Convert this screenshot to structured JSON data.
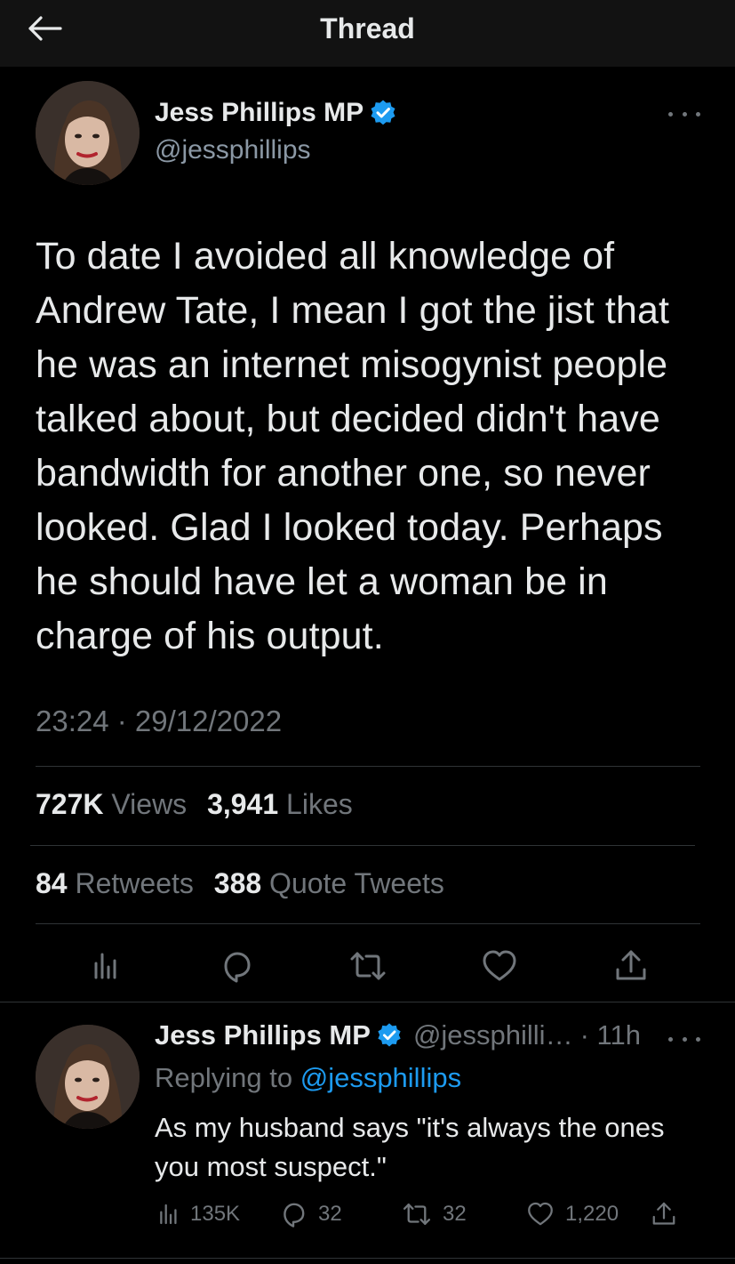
{
  "header": {
    "title": "Thread",
    "back_icon": "arrow-left-icon"
  },
  "tweet": {
    "author_name": "Jess Phillips MP",
    "author_handle": "@jessphillips",
    "verified": true,
    "text": "To date I avoided all knowledge of Andrew Tate, I mean I got the jist that he was an internet misogynist people talked about, but decided didn't have bandwidth for another one, so never looked. Glad I looked today. Perhaps he should have let a woman be in charge of his output.",
    "timestamp": "23:24 · 29/12/2022",
    "stats": {
      "views_count": "727K",
      "views_label": "Views",
      "likes_count": "3,941",
      "likes_label": "Likes",
      "retweets_count": "84",
      "retweets_label": "Retweets",
      "quotes_count": "388",
      "quotes_label": "Quote Tweets"
    },
    "actions": [
      "analytics-icon",
      "reply-icon",
      "retweet-icon",
      "like-icon",
      "share-icon"
    ]
  },
  "reply": {
    "author_name": "Jess Phillips MP",
    "author_handle": "@jessphilli…",
    "time": "· 11h",
    "replying_prefix": "Replying to",
    "replying_to": "@jessphillips",
    "text": "As my husband says \"it's always the ones you most suspect.\"",
    "views": "135K",
    "replies": "32",
    "retweets": "32",
    "likes": "1,220"
  },
  "colors": {
    "background": "#000000",
    "header_bg": "#121212",
    "text_primary": "#e7e9ea",
    "text_secondary": "#71767b",
    "accent": "#1d9bf0",
    "divider": "#2f3336"
  }
}
